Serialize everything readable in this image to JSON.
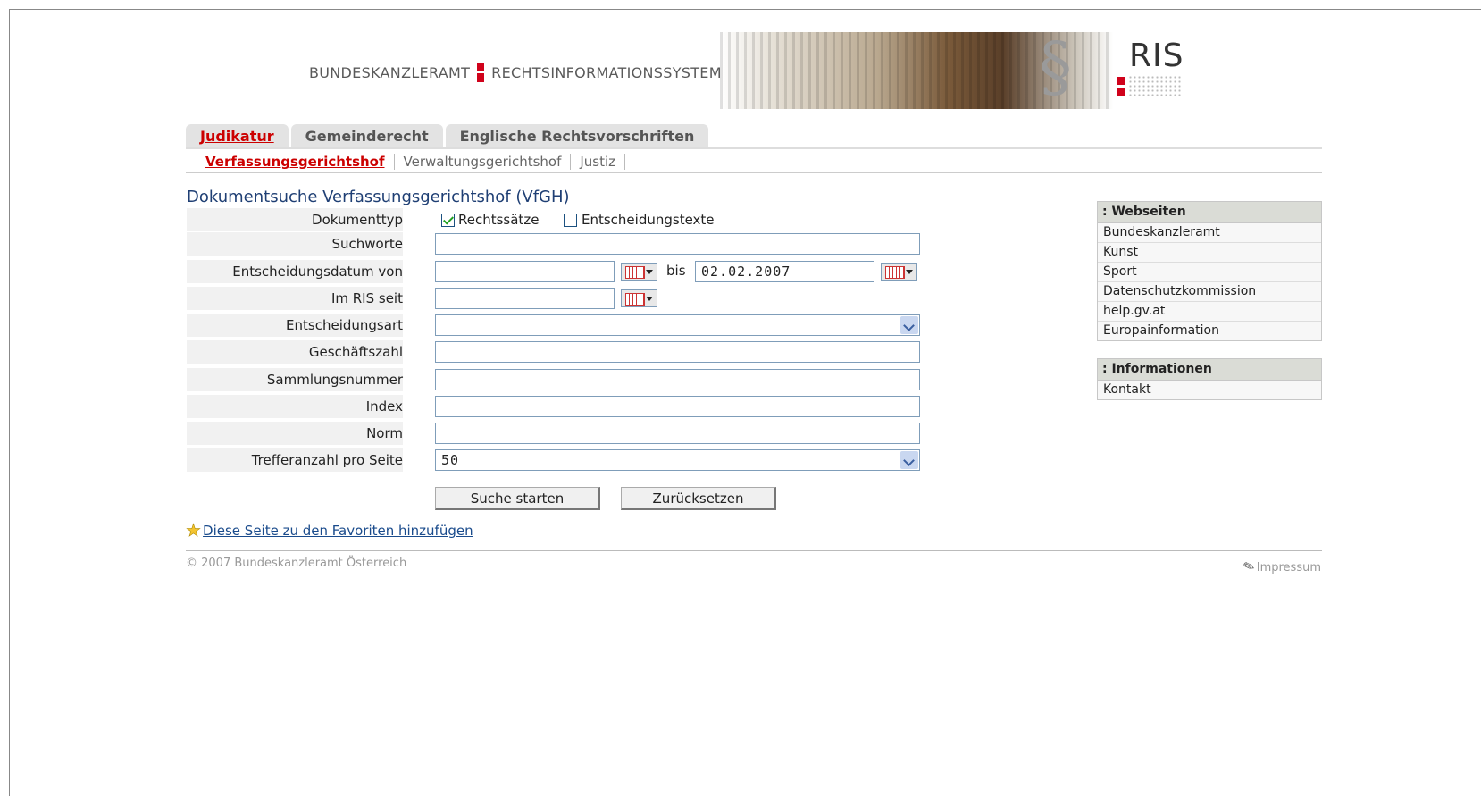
{
  "header": {
    "agency": "BUNDESKANZLERAMT",
    "system": "RECHTSINFORMATIONSSYSTEM",
    "logo_text": "RIS",
    "logo_symbol": "§"
  },
  "tabs": [
    {
      "label": "Judikatur",
      "active": true
    },
    {
      "label": "Gemeinderecht",
      "active": false
    },
    {
      "label": "Englische Rechtsvorschriften",
      "active": false
    }
  ],
  "subtabs": [
    {
      "label": "Verfassungsgerichtshof",
      "active": true
    },
    {
      "label": "Verwaltungsgerichtshof",
      "active": false
    },
    {
      "label": "Justiz",
      "active": false
    }
  ],
  "form": {
    "title": "Dokumentsuche Verfassungsgerichtshof (VfGH)",
    "dokumenttyp_label": "Dokumenttyp",
    "rechtssaetze_label": "Rechtssätze",
    "rechtssaetze_checked": true,
    "entscheidungstexte_label": "Entscheidungstexte",
    "entscheidungstexte_checked": false,
    "suchworte_label": "Suchworte",
    "suchworte_value": "",
    "datum_von_label": "Entscheidungsdatum von",
    "datum_von_value": "",
    "bis_label": "bis",
    "datum_bis_value": "02.02.2007",
    "ris_seit_label": "Im RIS seit",
    "ris_seit_value": "",
    "entscheidungsart_label": "Entscheidungsart",
    "entscheidungsart_value": "",
    "geschaeftszahl_label": "Geschäftszahl",
    "geschaeftszahl_value": "",
    "sammlungsnummer_label": "Sammlungsnummer",
    "sammlungsnummer_value": "",
    "index_label": "Index",
    "index_value": "",
    "norm_label": "Norm",
    "norm_value": "",
    "treffer_label": "Trefferanzahl pro Seite",
    "treffer_value": "50",
    "search_button": "Suche starten",
    "reset_button": "Zurücksetzen"
  },
  "favorites_link": "Diese Seite zu den Favoriten hinzufügen",
  "footer": {
    "copyright": "© 2007 Bundeskanzleramt Österreich",
    "impressum": "Impressum"
  },
  "sidebar": {
    "webseiten_title": ": Webseiten",
    "webseiten": [
      "Bundeskanzleramt",
      "Kunst",
      "Sport",
      "Datenschutzkommission",
      "help.gv.at",
      "Europainformation"
    ],
    "informationen_title": ": Informationen",
    "informationen": [
      "Kontakt"
    ]
  },
  "colors": {
    "accent_red": "#cc0000",
    "title_blue": "#1f3f74",
    "link_blue": "#1a4b8c",
    "label_bg": "#f1f1f1"
  }
}
